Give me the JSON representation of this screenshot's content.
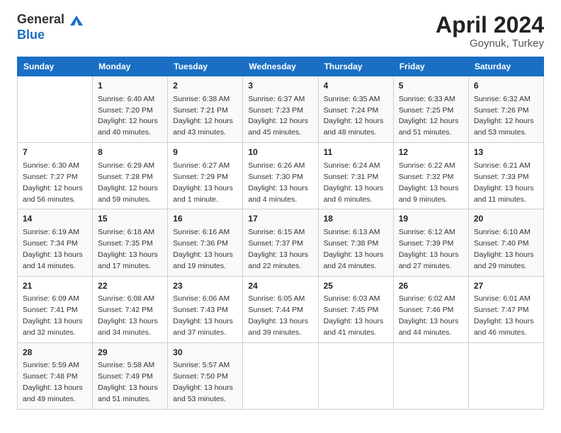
{
  "header": {
    "logo_general": "General",
    "logo_blue": "Blue",
    "month_year": "April 2024",
    "location": "Goynuk, Turkey"
  },
  "columns": [
    "Sunday",
    "Monday",
    "Tuesday",
    "Wednesday",
    "Thursday",
    "Friday",
    "Saturday"
  ],
  "weeks": [
    [
      {
        "day": "",
        "sunrise": "",
        "sunset": "",
        "daylight": ""
      },
      {
        "day": "1",
        "sunrise": "Sunrise: 6:40 AM",
        "sunset": "Sunset: 7:20 PM",
        "daylight": "Daylight: 12 hours and 40 minutes."
      },
      {
        "day": "2",
        "sunrise": "Sunrise: 6:38 AM",
        "sunset": "Sunset: 7:21 PM",
        "daylight": "Daylight: 12 hours and 43 minutes."
      },
      {
        "day": "3",
        "sunrise": "Sunrise: 6:37 AM",
        "sunset": "Sunset: 7:23 PM",
        "daylight": "Daylight: 12 hours and 45 minutes."
      },
      {
        "day": "4",
        "sunrise": "Sunrise: 6:35 AM",
        "sunset": "Sunset: 7:24 PM",
        "daylight": "Daylight: 12 hours and 48 minutes."
      },
      {
        "day": "5",
        "sunrise": "Sunrise: 6:33 AM",
        "sunset": "Sunset: 7:25 PM",
        "daylight": "Daylight: 12 hours and 51 minutes."
      },
      {
        "day": "6",
        "sunrise": "Sunrise: 6:32 AM",
        "sunset": "Sunset: 7:26 PM",
        "daylight": "Daylight: 12 hours and 53 minutes."
      }
    ],
    [
      {
        "day": "7",
        "sunrise": "Sunrise: 6:30 AM",
        "sunset": "Sunset: 7:27 PM",
        "daylight": "Daylight: 12 hours and 56 minutes."
      },
      {
        "day": "8",
        "sunrise": "Sunrise: 6:29 AM",
        "sunset": "Sunset: 7:28 PM",
        "daylight": "Daylight: 12 hours and 59 minutes."
      },
      {
        "day": "9",
        "sunrise": "Sunrise: 6:27 AM",
        "sunset": "Sunset: 7:29 PM",
        "daylight": "Daylight: 13 hours and 1 minute."
      },
      {
        "day": "10",
        "sunrise": "Sunrise: 6:26 AM",
        "sunset": "Sunset: 7:30 PM",
        "daylight": "Daylight: 13 hours and 4 minutes."
      },
      {
        "day": "11",
        "sunrise": "Sunrise: 6:24 AM",
        "sunset": "Sunset: 7:31 PM",
        "daylight": "Daylight: 13 hours and 6 minutes."
      },
      {
        "day": "12",
        "sunrise": "Sunrise: 6:22 AM",
        "sunset": "Sunset: 7:32 PM",
        "daylight": "Daylight: 13 hours and 9 minutes."
      },
      {
        "day": "13",
        "sunrise": "Sunrise: 6:21 AM",
        "sunset": "Sunset: 7:33 PM",
        "daylight": "Daylight: 13 hours and 11 minutes."
      }
    ],
    [
      {
        "day": "14",
        "sunrise": "Sunrise: 6:19 AM",
        "sunset": "Sunset: 7:34 PM",
        "daylight": "Daylight: 13 hours and 14 minutes."
      },
      {
        "day": "15",
        "sunrise": "Sunrise: 6:18 AM",
        "sunset": "Sunset: 7:35 PM",
        "daylight": "Daylight: 13 hours and 17 minutes."
      },
      {
        "day": "16",
        "sunrise": "Sunrise: 6:16 AM",
        "sunset": "Sunset: 7:36 PM",
        "daylight": "Daylight: 13 hours and 19 minutes."
      },
      {
        "day": "17",
        "sunrise": "Sunrise: 6:15 AM",
        "sunset": "Sunset: 7:37 PM",
        "daylight": "Daylight: 13 hours and 22 minutes."
      },
      {
        "day": "18",
        "sunrise": "Sunrise: 6:13 AM",
        "sunset": "Sunset: 7:38 PM",
        "daylight": "Daylight: 13 hours and 24 minutes."
      },
      {
        "day": "19",
        "sunrise": "Sunrise: 6:12 AM",
        "sunset": "Sunset: 7:39 PM",
        "daylight": "Daylight: 13 hours and 27 minutes."
      },
      {
        "day": "20",
        "sunrise": "Sunrise: 6:10 AM",
        "sunset": "Sunset: 7:40 PM",
        "daylight": "Daylight: 13 hours and 29 minutes."
      }
    ],
    [
      {
        "day": "21",
        "sunrise": "Sunrise: 6:09 AM",
        "sunset": "Sunset: 7:41 PM",
        "daylight": "Daylight: 13 hours and 32 minutes."
      },
      {
        "day": "22",
        "sunrise": "Sunrise: 6:08 AM",
        "sunset": "Sunset: 7:42 PM",
        "daylight": "Daylight: 13 hours and 34 minutes."
      },
      {
        "day": "23",
        "sunrise": "Sunrise: 6:06 AM",
        "sunset": "Sunset: 7:43 PM",
        "daylight": "Daylight: 13 hours and 37 minutes."
      },
      {
        "day": "24",
        "sunrise": "Sunrise: 6:05 AM",
        "sunset": "Sunset: 7:44 PM",
        "daylight": "Daylight: 13 hours and 39 minutes."
      },
      {
        "day": "25",
        "sunrise": "Sunrise: 6:03 AM",
        "sunset": "Sunset: 7:45 PM",
        "daylight": "Daylight: 13 hours and 41 minutes."
      },
      {
        "day": "26",
        "sunrise": "Sunrise: 6:02 AM",
        "sunset": "Sunset: 7:46 PM",
        "daylight": "Daylight: 13 hours and 44 minutes."
      },
      {
        "day": "27",
        "sunrise": "Sunrise: 6:01 AM",
        "sunset": "Sunset: 7:47 PM",
        "daylight": "Daylight: 13 hours and 46 minutes."
      }
    ],
    [
      {
        "day": "28",
        "sunrise": "Sunrise: 5:59 AM",
        "sunset": "Sunset: 7:48 PM",
        "daylight": "Daylight: 13 hours and 49 minutes."
      },
      {
        "day": "29",
        "sunrise": "Sunrise: 5:58 AM",
        "sunset": "Sunset: 7:49 PM",
        "daylight": "Daylight: 13 hours and 51 minutes."
      },
      {
        "day": "30",
        "sunrise": "Sunrise: 5:57 AM",
        "sunset": "Sunset: 7:50 PM",
        "daylight": "Daylight: 13 hours and 53 minutes."
      },
      {
        "day": "",
        "sunrise": "",
        "sunset": "",
        "daylight": ""
      },
      {
        "day": "",
        "sunrise": "",
        "sunset": "",
        "daylight": ""
      },
      {
        "day": "",
        "sunrise": "",
        "sunset": "",
        "daylight": ""
      },
      {
        "day": "",
        "sunrise": "",
        "sunset": "",
        "daylight": ""
      }
    ]
  ]
}
